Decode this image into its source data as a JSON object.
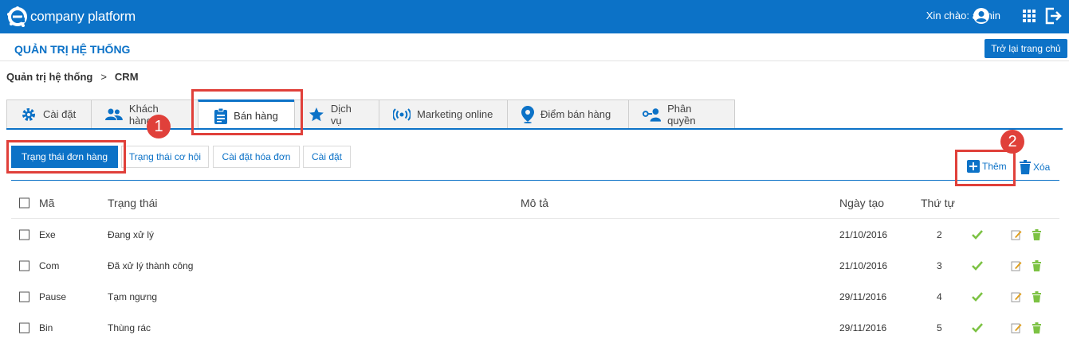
{
  "app": {
    "logo_text": "company platform",
    "greeting": "Xin chào: admin",
    "icons": [
      "logo-icon",
      "user-icon",
      "apps-icon",
      "logout-icon"
    ],
    "brand_color": "#0c72c7"
  },
  "header": {
    "title": "QUẢN TRỊ HỆ THỐNG",
    "home_button": "Trở lại trang chủ"
  },
  "breadcrumb": {
    "items": [
      "Quản trị hệ thống",
      "CRM"
    ],
    "separator": ">"
  },
  "tabs": [
    {
      "label": "Cài đặt",
      "icon": "gear-icon",
      "active": false
    },
    {
      "label": "Khách hàng",
      "icon": "users-icon",
      "active": false
    },
    {
      "label": "Bán hàng",
      "icon": "clipboard-icon",
      "active": true
    },
    {
      "label": "Dịch vụ",
      "icon": "star-icon",
      "active": false
    },
    {
      "label": "Marketing online",
      "icon": "broadcast-icon",
      "active": false
    },
    {
      "label": "Điểm bán hàng",
      "icon": "map-pin-icon",
      "active": false
    },
    {
      "label": "Phân quyền",
      "icon": "user-key-icon",
      "active": false
    }
  ],
  "subtabs": [
    {
      "label": "Trạng thái đơn hàng",
      "active": true
    },
    {
      "label": "Trạng thái cơ hội",
      "active": false
    },
    {
      "label": "Cài đặt hóa đơn",
      "active": false
    },
    {
      "label": "Cài đặt",
      "active": false
    }
  ],
  "actions": {
    "add_label": "Thêm",
    "delete_label": "Xóa"
  },
  "callouts": {
    "badge1": "1",
    "badge2": "2",
    "color": "#e0403a"
  },
  "table": {
    "headers": {
      "code": "Mã",
      "status": "Trạng thái",
      "description": "Mô tả",
      "created": "Ngày tạo",
      "order": "Thứ tự"
    },
    "rows": [
      {
        "code": "Exe",
        "status": "Đang xử lý",
        "description": "",
        "created": "21/10/2016",
        "order": "2"
      },
      {
        "code": "Com",
        "status": "Đã xử lý thành công",
        "description": "",
        "created": "21/10/2016",
        "order": "3"
      },
      {
        "code": "Pause",
        "status": "Tạm ngưng",
        "description": "",
        "created": "29/11/2016",
        "order": "4"
      },
      {
        "code": "Bin",
        "status": "Thùng rác",
        "description": "",
        "created": "29/11/2016",
        "order": "5"
      }
    ]
  }
}
